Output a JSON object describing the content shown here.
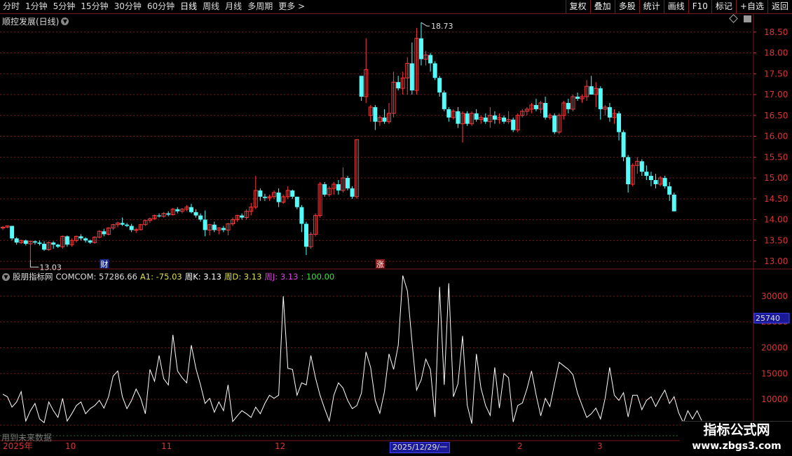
{
  "toolbar": {
    "periods": [
      "分时",
      "1分钟",
      "5分钟",
      "15分钟",
      "30分钟",
      "60分钟",
      "日线",
      "周线",
      "月线",
      "多周期",
      "更多 >"
    ],
    "active_period": "日线",
    "buttons": [
      "复权",
      "叠加",
      "多股",
      "统计",
      "画线",
      "F10",
      "标记",
      "+自选",
      "返回"
    ]
  },
  "chart": {
    "title": "顺控发展(日线)",
    "high_label": "18.73",
    "low_label": "13.03",
    "marker_cai": "财",
    "marker_zhang": "涨",
    "price_axis": [
      "18.50",
      "18.00",
      "17.50",
      "17.00",
      "16.50",
      "16.00",
      "15.50",
      "15.00",
      "14.50",
      "14.00",
      "13.50",
      "13.00"
    ]
  },
  "indicator": {
    "name": "股朋指标网",
    "comcom": "COMCOM: 57286.66",
    "a1": "A1: -75.03",
    "k": "周K: 3.13",
    "d": "周D: 3.13",
    "j_label": "周J: 3.13",
    "j_extra": ": 100.00",
    "axis": [
      "30000",
      "25000",
      "20000",
      "15000",
      "10000",
      "5000"
    ],
    "cursor_value": "25740",
    "future_note": "用到未来数据"
  },
  "date_axis": {
    "labels": [
      "2025年",
      "10",
      "11",
      "12",
      "2",
      "3"
    ],
    "cursor_date": "2025/12/29/一"
  },
  "watermark": {
    "line1": "指标公式网",
    "line2": "www.zbgs3.com"
  },
  "colors": {
    "up": "#ff3b3b",
    "down": "#54fcfc",
    "grid": "#7a1a1a",
    "a1": "#e0e040",
    "k": "#ffffff",
    "d": "#e0e040",
    "j": "#e040e0",
    "extra": "#40e040"
  },
  "chart_data": {
    "type": "candlestick",
    "price_ylim": [
      12.85,
      18.9
    ],
    "candles": [
      [
        13.8,
        13.85,
        13.75,
        13.82
      ],
      [
        13.82,
        13.86,
        13.8,
        13.85
      ],
      [
        13.85,
        13.85,
        13.5,
        13.55
      ],
      [
        13.55,
        13.58,
        13.4,
        13.45
      ],
      [
        13.45,
        13.52,
        13.42,
        13.5
      ],
      [
        13.5,
        13.52,
        13.38,
        13.42
      ],
      [
        13.42,
        13.5,
        13.03,
        13.48
      ],
      [
        13.48,
        13.5,
        13.4,
        13.45
      ],
      [
        13.45,
        13.5,
        13.38,
        13.42
      ],
      [
        13.42,
        13.48,
        13.25,
        13.28
      ],
      [
        13.28,
        13.48,
        13.25,
        13.45
      ],
      [
        13.45,
        13.48,
        13.3,
        13.4
      ],
      [
        13.4,
        13.42,
        13.32,
        13.35
      ],
      [
        13.35,
        13.62,
        13.3,
        13.6
      ],
      [
        13.6,
        13.62,
        13.35,
        13.4
      ],
      [
        13.4,
        13.55,
        13.35,
        13.5
      ],
      [
        13.5,
        13.62,
        13.45,
        13.6
      ],
      [
        13.6,
        13.65,
        13.5,
        13.55
      ],
      [
        13.55,
        13.58,
        13.45,
        13.5
      ],
      [
        13.5,
        13.52,
        13.42,
        13.45
      ],
      [
        13.45,
        13.6,
        13.42,
        13.58
      ],
      [
        13.58,
        13.75,
        13.55,
        13.72
      ],
      [
        13.72,
        13.78,
        13.6,
        13.65
      ],
      [
        13.65,
        13.82,
        13.62,
        13.8
      ],
      [
        13.8,
        13.9,
        13.75,
        13.88
      ],
      [
        13.88,
        13.95,
        13.82,
        13.92
      ],
      [
        13.92,
        14.05,
        13.85,
        13.88
      ],
      [
        13.88,
        13.92,
        13.82,
        13.85
      ],
      [
        13.85,
        13.9,
        13.7,
        13.75
      ],
      [
        13.75,
        13.8,
        13.68,
        13.76
      ],
      [
        13.76,
        13.9,
        13.74,
        13.88
      ],
      [
        13.88,
        14.0,
        13.85,
        13.98
      ],
      [
        13.98,
        14.05,
        13.92,
        14.02
      ],
      [
        14.02,
        14.12,
        14.0,
        14.1
      ],
      [
        14.1,
        14.15,
        14.05,
        14.08
      ],
      [
        14.08,
        14.18,
        14.05,
        14.15
      ],
      [
        14.15,
        14.2,
        14.08,
        14.12
      ],
      [
        14.12,
        14.28,
        14.1,
        14.25
      ],
      [
        14.25,
        14.3,
        14.15,
        14.2
      ],
      [
        14.2,
        14.28,
        14.15,
        14.25
      ],
      [
        14.25,
        14.35,
        14.2,
        14.3
      ],
      [
        14.3,
        14.38,
        14.15,
        14.18
      ],
      [
        14.18,
        14.25,
        14.05,
        14.1
      ],
      [
        14.1,
        14.15,
        13.95,
        14.0
      ],
      [
        14.0,
        14.22,
        13.6,
        13.75
      ],
      [
        13.75,
        13.9,
        13.62,
        13.88
      ],
      [
        13.88,
        13.95,
        13.7,
        13.75
      ],
      [
        13.75,
        13.82,
        13.65,
        13.8
      ],
      [
        13.8,
        13.85,
        13.7,
        13.75
      ],
      [
        13.75,
        13.92,
        13.62,
        13.9
      ],
      [
        13.9,
        14.05,
        13.85,
        14.0
      ],
      [
        14.0,
        14.12,
        13.95,
        14.1
      ],
      [
        14.1,
        14.15,
        14.0,
        14.05
      ],
      [
        14.05,
        14.25,
        14.0,
        14.2
      ],
      [
        14.2,
        14.4,
        14.1,
        14.3
      ],
      [
        14.3,
        15.05,
        14.25,
        14.7
      ],
      [
        14.7,
        14.75,
        14.45,
        14.55
      ],
      [
        14.55,
        14.62,
        14.45,
        14.52
      ],
      [
        14.52,
        14.6,
        14.45,
        14.55
      ],
      [
        14.55,
        14.7,
        14.5,
        14.65
      ],
      [
        14.65,
        14.75,
        14.3,
        14.42
      ],
      [
        14.42,
        14.6,
        14.38,
        14.55
      ],
      [
        14.55,
        14.8,
        14.5,
        14.7
      ],
      [
        14.7,
        14.72,
        14.5,
        14.55
      ],
      [
        14.55,
        14.55,
        14.25,
        14.3
      ],
      [
        14.3,
        14.35,
        13.7,
        13.9
      ],
      [
        13.9,
        13.95,
        13.15,
        13.35
      ],
      [
        13.35,
        13.7,
        13.3,
        13.65
      ],
      [
        13.65,
        14.15,
        13.6,
        14.1
      ],
      [
        14.1,
        14.9,
        14.05,
        14.85
      ],
      [
        14.85,
        14.9,
        14.55,
        14.6
      ],
      [
        14.6,
        14.8,
        14.55,
        14.75
      ],
      [
        14.75,
        14.9,
        14.6,
        14.85
      ],
      [
        14.85,
        14.95,
        14.6,
        14.7
      ],
      [
        14.7,
        15.25,
        14.65,
        15.0
      ],
      [
        15.0,
        15.05,
        14.7,
        14.75
      ],
      [
        14.75,
        14.8,
        14.5,
        14.55
      ],
      [
        14.55,
        15.92,
        14.5,
        15.92
      ],
      [
        17.45,
        17.45,
        16.85,
        16.95
      ],
      [
        16.95,
        18.35,
        16.8,
        17.6
      ],
      [
        16.5,
        16.75,
        16.35,
        16.7
      ],
      [
        16.7,
        16.75,
        16.15,
        16.35
      ],
      [
        16.35,
        16.5,
        16.25,
        16.45
      ],
      [
        16.45,
        16.65,
        16.3,
        16.35
      ],
      [
        16.35,
        16.8,
        16.3,
        16.55
      ],
      [
        16.55,
        17.55,
        16.45,
        17.3
      ],
      [
        17.3,
        17.45,
        17.1,
        17.15
      ],
      [
        17.15,
        17.55,
        17.0,
        17.4
      ],
      [
        17.4,
        17.9,
        17.0,
        17.75
      ],
      [
        17.75,
        18.25,
        17.0,
        17.1
      ],
      [
        17.1,
        18.6,
        17.0,
        18.35
      ],
      [
        18.35,
        18.73,
        17.7,
        17.85
      ],
      [
        17.85,
        18.05,
        17.7,
        17.95
      ],
      [
        17.95,
        18.0,
        17.55,
        17.75
      ],
      [
        17.75,
        17.8,
        17.35,
        17.4
      ],
      [
        17.4,
        17.45,
        16.95,
        17.05
      ],
      [
        17.05,
        17.1,
        16.6,
        16.65
      ],
      [
        16.65,
        16.7,
        16.35,
        16.45
      ],
      [
        16.45,
        16.65,
        16.4,
        16.6
      ],
      [
        16.6,
        16.7,
        16.2,
        16.3
      ],
      [
        16.3,
        16.6,
        15.85,
        16.55
      ],
      [
        16.55,
        16.6,
        16.25,
        16.3
      ],
      [
        16.3,
        16.6,
        16.25,
        16.55
      ],
      [
        16.55,
        16.65,
        16.35,
        16.4
      ],
      [
        16.4,
        16.5,
        16.3,
        16.45
      ],
      [
        16.45,
        16.55,
        16.3,
        16.35
      ],
      [
        16.35,
        16.7,
        16.2,
        16.5
      ],
      [
        16.5,
        16.6,
        16.3,
        16.4
      ],
      [
        16.4,
        16.55,
        16.3,
        16.45
      ],
      [
        16.45,
        16.5,
        16.3,
        16.35
      ],
      [
        16.35,
        16.6,
        16.3,
        16.4
      ],
      [
        16.4,
        16.45,
        16.1,
        16.15
      ],
      [
        16.15,
        16.55,
        16.1,
        16.5
      ],
      [
        16.5,
        16.65,
        16.45,
        16.6
      ],
      [
        16.6,
        16.7,
        16.5,
        16.65
      ],
      [
        16.65,
        16.8,
        16.55,
        16.75
      ],
      [
        16.75,
        16.9,
        16.6,
        16.65
      ],
      [
        16.65,
        16.85,
        16.55,
        16.8
      ],
      [
        16.8,
        16.95,
        16.4,
        16.45
      ],
      [
        16.45,
        16.55,
        16.4,
        16.5
      ],
      [
        16.5,
        16.55,
        16.05,
        16.1
      ],
      [
        16.1,
        16.55,
        16.05,
        16.5
      ],
      [
        16.5,
        16.85,
        16.4,
        16.8
      ],
      [
        16.8,
        16.9,
        16.55,
        16.65
      ],
      [
        16.65,
        17.0,
        16.6,
        16.95
      ],
      [
        16.95,
        17.05,
        16.85,
        16.9
      ],
      [
        16.9,
        17.0,
        16.8,
        16.95
      ],
      [
        16.95,
        17.35,
        16.85,
        17.2
      ],
      [
        17.2,
        17.45,
        17.15,
        17.0
      ],
      [
        17.0,
        17.3,
        16.7,
        17.15
      ],
      [
        17.15,
        17.2,
        16.4,
        16.65
      ],
      [
        16.65,
        16.75,
        16.5,
        16.7
      ],
      [
        16.7,
        16.8,
        16.35,
        16.45
      ],
      [
        16.45,
        16.65,
        16.3,
        16.55
      ],
      [
        16.55,
        16.6,
        15.9,
        16.1
      ],
      [
        16.1,
        16.15,
        15.4,
        15.5
      ],
      [
        15.5,
        15.55,
        14.65,
        14.85
      ],
      [
        14.85,
        15.35,
        14.8,
        15.3
      ],
      [
        15.3,
        15.5,
        15.1,
        15.4
      ],
      [
        15.4,
        15.45,
        15.05,
        15.15
      ],
      [
        15.15,
        15.3,
        14.95,
        15.05
      ],
      [
        15.05,
        15.15,
        14.8,
        14.95
      ],
      [
        14.95,
        15.1,
        14.75,
        14.85
      ],
      [
        14.85,
        15.05,
        14.8,
        15.0
      ],
      [
        15.0,
        15.05,
        14.75,
        14.8
      ],
      [
        14.8,
        14.9,
        14.45,
        14.6
      ],
      [
        14.6,
        14.65,
        14.2,
        14.2
      ]
    ],
    "cai_index": 22,
    "zhang_index": 82,
    "indicator_ylim": [
      3500,
      35000
    ],
    "indicator_values": [
      11000,
      10500,
      8500,
      9500,
      11500,
      5800,
      7800,
      9200,
      6200,
      5500,
      9500,
      7800,
      6500,
      10200,
      5800,
      7200,
      8800,
      9500,
      7200,
      8200,
      8800,
      9800,
      8300,
      10500,
      14500,
      15500,
      10500,
      8200,
      9800,
      12000,
      10200,
      7200,
      15800,
      13500,
      18500,
      14000,
      12800,
      22500,
      15500,
      14200,
      13200,
      20500,
      16000,
      12800,
      9200,
      10200,
      7500,
      9500,
      7800,
      12800,
      5700,
      6800,
      7800,
      7200,
      6500,
      8500,
      7200,
      9200,
      10800,
      10200,
      10800,
      30000,
      16000,
      15800,
      10800,
      13200,
      12800,
      18500,
      14200,
      10800,
      8200,
      5800,
      10800,
      13200,
      12200,
      9800,
      8200,
      8800,
      11200,
      19200,
      16200,
      9800,
      7300,
      11500,
      18800,
      15800,
      20500,
      34000,
      31000,
      21200,
      11800,
      13800,
      17800,
      15800,
      6600,
      31800,
      12800,
      32500,
      10500,
      13000,
      22300,
      8900,
      5300,
      18800,
      12200,
      8800,
      6900,
      16200,
      8300,
      15000,
      14200,
      5600,
      8800,
      9300,
      12000,
      15500,
      10800,
      6800,
      10200,
      8600,
      13000,
      17200,
      16500,
      15800,
      14800,
      11200,
      8800,
      6500,
      7200,
      8300,
      6200,
      10200,
      16200,
      10800,
      9800,
      11300,
      6600,
      10800,
      10800,
      8000,
      9800,
      10500,
      8600,
      10300,
      11800,
      9200,
      10500,
      7400,
      5500,
      7800,
      6200,
      7800,
      5900
    ]
  }
}
